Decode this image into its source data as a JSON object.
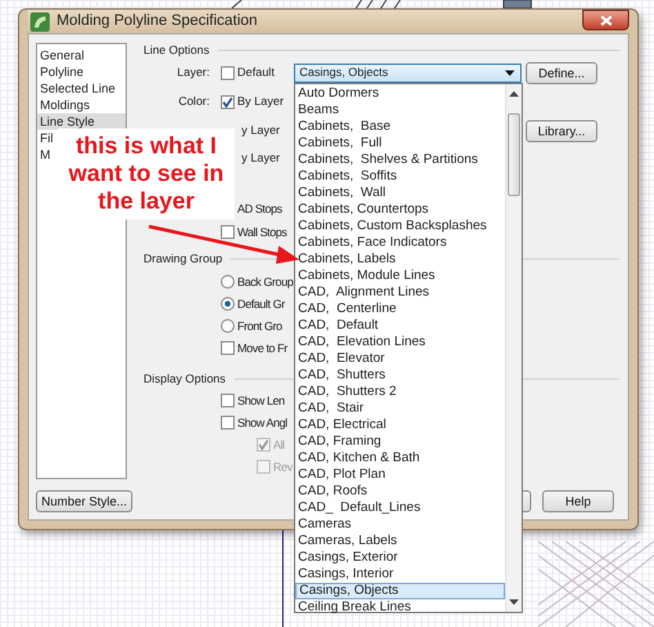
{
  "window": {
    "title": "Molding Polyline Specification"
  },
  "sidebar": {
    "items": [
      {
        "label": "General",
        "selected": false
      },
      {
        "label": "Polyline",
        "selected": false
      },
      {
        "label": "Selected Line",
        "selected": false
      },
      {
        "label": "Moldings",
        "selected": false
      },
      {
        "label": "Line Style",
        "selected": true
      },
      {
        "label": "Fil",
        "selected": false
      },
      {
        "label": "M",
        "selected": false
      }
    ]
  },
  "line_options": {
    "title": "Line Options",
    "layer": {
      "label": "Layer:",
      "checked": false,
      "option": "Default",
      "value": "Casings, Objects",
      "expanded": true
    },
    "color": {
      "label": "Color:",
      "checked": true,
      "option": "By Layer"
    },
    "row_3_option": "y Layer",
    "row_4_option": "y Layer",
    "define_button": "Define...",
    "library_button": "Library...",
    "stops": [
      {
        "label": "AD Stops"
      },
      {
        "label": "Wall Stops",
        "checked": false
      }
    ]
  },
  "drawing_group": {
    "title": "Drawing Group",
    "options": [
      {
        "kind": "radio",
        "label": "Back Group",
        "selected": false
      },
      {
        "kind": "radio",
        "label": "Default Gr",
        "selected": true
      },
      {
        "kind": "radio",
        "label": "Front Gro",
        "selected": false
      },
      {
        "kind": "checkbox",
        "label": "Move to Fr",
        "checked": false
      }
    ]
  },
  "display_options": {
    "title": "Display Options",
    "options": [
      {
        "label": "Show Len",
        "checked": false,
        "disabled": false
      },
      {
        "label": "Show Angl",
        "checked": false,
        "disabled": false
      },
      {
        "label": "All",
        "checked": true,
        "disabled": true
      },
      {
        "label": "Rev",
        "checked": false,
        "disabled": true
      }
    ]
  },
  "buttons": {
    "number_style": "Number Style...",
    "help": "Help"
  },
  "layer_list": {
    "items": [
      {
        "label": "Auto Dormers",
        "selected": false
      },
      {
        "label": "Beams",
        "selected": false
      },
      {
        "label": "Cabinets,  Base",
        "selected": false
      },
      {
        "label": "Cabinets,  Full",
        "selected": false
      },
      {
        "label": "Cabinets,  Shelves & Partitions",
        "selected": false
      },
      {
        "label": "Cabinets,  Soffits",
        "selected": false
      },
      {
        "label": "Cabinets,  Wall",
        "selected": false
      },
      {
        "label": "Cabinets, Countertops",
        "selected": false
      },
      {
        "label": "Cabinets, Custom Backsplashes",
        "selected": false
      },
      {
        "label": "Cabinets, Face Indicators",
        "selected": false
      },
      {
        "label": "Cabinets, Labels",
        "selected": false
      },
      {
        "label": "Cabinets, Module Lines",
        "selected": false
      },
      {
        "label": "CAD,  Alignment Lines",
        "selected": false
      },
      {
        "label": "CAD,  Centerline",
        "selected": false
      },
      {
        "label": "CAD,  Default",
        "selected": false
      },
      {
        "label": "CAD,  Elevation Lines",
        "selected": false
      },
      {
        "label": "CAD,  Elevator",
        "selected": false
      },
      {
        "label": "CAD,  Shutters",
        "selected": false
      },
      {
        "label": "CAD,  Shutters 2",
        "selected": false
      },
      {
        "label": "CAD,  Stair",
        "selected": false
      },
      {
        "label": "CAD, Electrical",
        "selected": false
      },
      {
        "label": "CAD, Framing",
        "selected": false
      },
      {
        "label": "CAD, Kitchen & Bath",
        "selected": false
      },
      {
        "label": "CAD, Plot Plan",
        "selected": false
      },
      {
        "label": "CAD, Roofs",
        "selected": false
      },
      {
        "label": "CAD_  Default_Lines",
        "selected": false
      },
      {
        "label": "Cameras",
        "selected": false
      },
      {
        "label": "Cameras, Labels",
        "selected": false
      },
      {
        "label": "Casings, Exterior",
        "selected": false
      },
      {
        "label": "Casings, Interior",
        "selected": false
      },
      {
        "label": "Casings, Objects",
        "selected": true
      },
      {
        "label": "Ceiling Break Lines",
        "selected": false
      }
    ]
  },
  "annotation": {
    "text": "this is what I want to see in the layer"
  }
}
